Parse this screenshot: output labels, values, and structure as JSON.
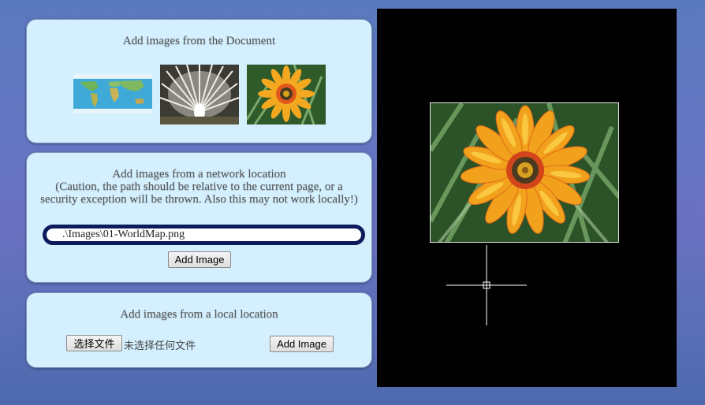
{
  "document_panel": {
    "title": "Add images from the Document",
    "thumbnails": [
      {
        "icon": "world-map-image"
      },
      {
        "icon": "white-peacock-image"
      },
      {
        "icon": "orange-flower-image"
      }
    ]
  },
  "network_panel": {
    "title": "Add images from a network location",
    "caution": "(Caution, the path should be relative to the current page, or a security exception will be thrown. Also this may not work locally!)",
    "path_value": ".\\Images\\01-WorldMap.png",
    "add_button": "Add Image"
  },
  "local_panel": {
    "title": "Add images from a local location",
    "choose_file_button": "选择文件",
    "no_file_text": "未选择任何文件",
    "add_button": "Add Image"
  },
  "canvas": {
    "background": "#000000",
    "image": "orange-flower-image",
    "cursor": "crosshair-icon"
  },
  "colors": {
    "panel_background": "#d4f0ff",
    "input_border": "#0d1b5c"
  }
}
